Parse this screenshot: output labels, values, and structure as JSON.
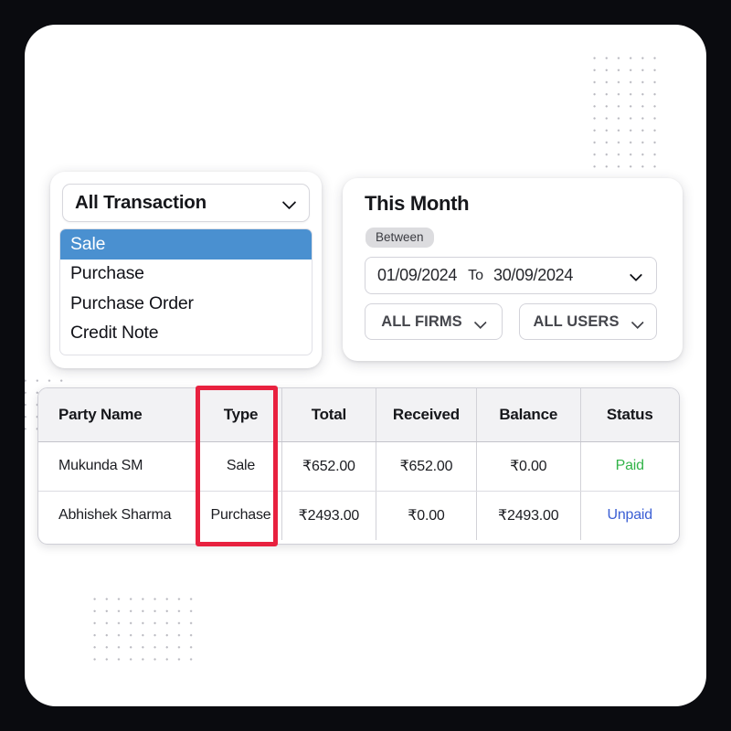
{
  "transaction_filter": {
    "selected_label": "All Transaction",
    "chevron_icon": "chevron-down-icon",
    "options": [
      {
        "label": "Sale",
        "selected": true
      },
      {
        "label": "Purchase",
        "selected": false
      },
      {
        "label": "Purchase Order",
        "selected": false
      },
      {
        "label": "Credit Note",
        "selected": false
      }
    ]
  },
  "date_filter": {
    "title": "This Month",
    "badge": "Between",
    "from_date": "01/09/2024",
    "separator": "To",
    "to_date": "30/09/2024",
    "date_chevron_icon": "chevron-down-icon",
    "firms_label": "ALL FIRMS",
    "firms_chevron_icon": "chevron-down-icon",
    "users_label": "ALL USERS",
    "users_chevron_icon": "chevron-down-icon"
  },
  "table": {
    "headers": [
      "Party Name",
      "Type",
      "Total",
      "Received",
      "Balance",
      "Status"
    ],
    "rows": [
      {
        "party_name": "Mukunda SM",
        "type": "Sale",
        "total": "₹652.00",
        "received": "₹652.00",
        "balance": "₹0.00",
        "status": "Paid",
        "status_kind": "paid"
      },
      {
        "party_name": "Abhishek Sharma",
        "type": "Purchase",
        "total": "₹2493.00",
        "received": "₹0.00",
        "balance": "₹2493.00",
        "status": "Unpaid",
        "status_kind": "unpaid"
      }
    ]
  },
  "annotation": {
    "highlight_target": "Type",
    "highlight_color": "#e8213f"
  },
  "colors": {
    "selected_option_bg": "#4a90d0",
    "paid": "#33b44a",
    "unpaid": "#3b5fd4",
    "header_bg": "#f2f2f4",
    "frame": "#0a0b0f"
  }
}
